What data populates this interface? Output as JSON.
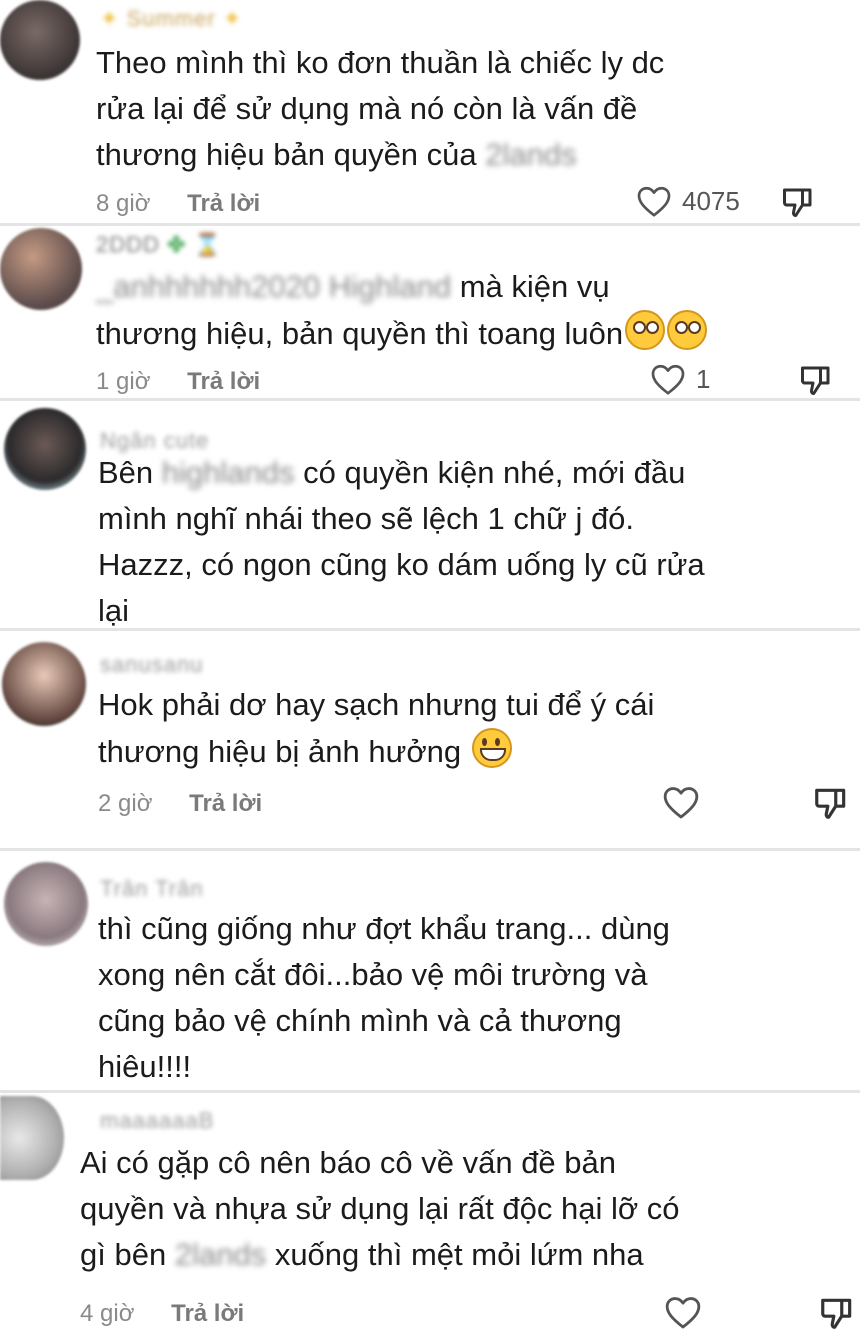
{
  "comments": [
    {
      "username": "Summer",
      "lines": [
        "Theo mình thì ko đơn thuần là chiếc ly dc",
        "rửa lại để sử dụng mà nó còn là vấn đề",
        "thương hiệu bản quyền của"
      ],
      "mention": "2lands",
      "time": "8 giờ",
      "reply": "Trả lời",
      "likes": "4075"
    },
    {
      "username": "2DDD",
      "mention": "_anhhhhhh2020 Highland",
      "lines": [
        "mà kiện vụ",
        "thương hiệu, bản quyền thì toang luôn"
      ],
      "time": "1 giờ",
      "reply": "Trả lời",
      "likes": "1"
    },
    {
      "username": "Ngân cute",
      "prefix": "Bên",
      "mention": "highlands",
      "lines": [
        "có quyền kiện nhé, mới đầu",
        "mình nghĩ nhái theo sẽ lệch 1 chữ j đó.",
        "Hazzz, có ngon cũng ko dám uống ly cũ rửa",
        "lại"
      ]
    },
    {
      "username": "sanusanu",
      "lines": [
        "Hok phải dơ hay sạch nhưng tui để ý cái",
        "thương hiệu bị ảnh hưởng"
      ],
      "time": "2 giờ",
      "reply": "Trả lời"
    },
    {
      "username": "Trân Trân",
      "lines": [
        "thì cũng giống như đợt khẩu trang... dùng",
        "xong nên cắt đôi...bảo vệ môi trường và",
        "cũng bảo vệ chính mình và cả thương",
        "hiêu!!!!"
      ]
    },
    {
      "username": "maaaaaaB",
      "lines": [
        "Ai có gặp cô nên báo cô về vấn đề bản",
        "quyền và nhựa sử dụng lại rất độc hại lỡ có",
        "gì bên",
        "xuống thì mệt mỏi lứm nha"
      ],
      "mention": "2lands",
      "time": "4 giờ",
      "reply": "Trả lời"
    }
  ],
  "icons": {
    "like": "heart-outline-icon",
    "dislike": "thumbs-down-icon"
  },
  "colors": {
    "text": "#1b1b1b",
    "meta": "#8a8a8a",
    "divider": "#e4e4e4",
    "emoji": "#ffcb3d"
  }
}
